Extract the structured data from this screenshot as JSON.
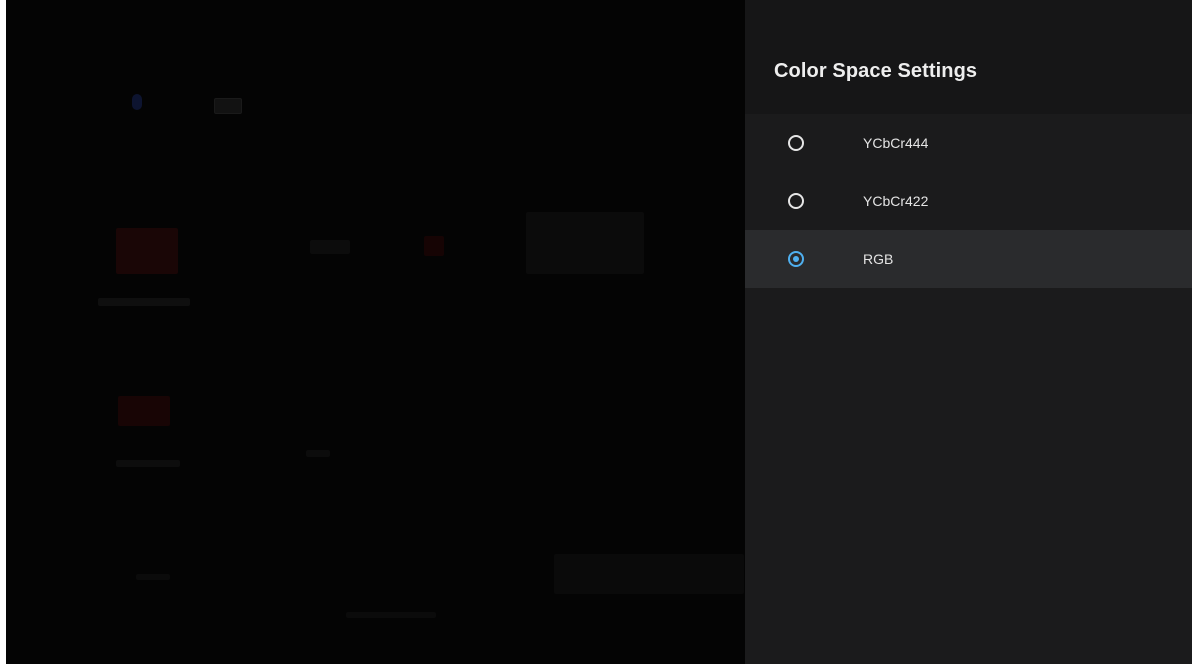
{
  "panel": {
    "title": "Color Space Settings",
    "options": [
      {
        "label": "YCbCr444",
        "selected": false
      },
      {
        "label": "YCbCr422",
        "selected": false
      },
      {
        "label": "RGB",
        "selected": true
      }
    ]
  },
  "colors": {
    "accent": "#4fb0f0",
    "panel_bg": "#1b1b1c",
    "header_bg": "#161617",
    "selected_row_bg": "#2a2b2d",
    "backdrop": "#050505"
  },
  "icons": {
    "radio_unchecked": "radio-unchecked-icon",
    "radio_checked": "radio-checked-icon",
    "background_mic": "microphone-icon",
    "background_keyboard": "keyboard-icon"
  }
}
